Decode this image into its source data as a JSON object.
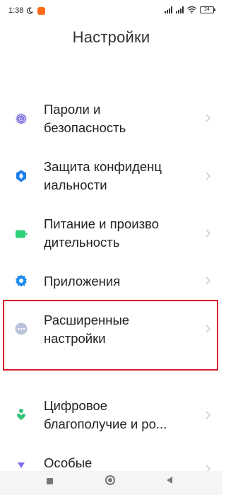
{
  "status_bar": {
    "time": "1:38",
    "battery": "24",
    "icons": [
      "moon-icon",
      "app-badge-icon",
      "signal-icon",
      "signal-icon-2",
      "wifi-icon",
      "battery-icon"
    ]
  },
  "page": {
    "title": "Настройки"
  },
  "settings": {
    "items": [
      {
        "label": "Пароли и\nбезопасность",
        "icon": "fingerprint-icon",
        "icon_color": "#6b5fd6"
      },
      {
        "label": "Защита конфиденц\nиальности",
        "icon": "privacy-icon",
        "icon_color": "#1f7fe8"
      },
      {
        "label": "Питание и произво\nдительность",
        "icon": "battery-power-icon",
        "icon_color": "#2fd17a"
      },
      {
        "label": "Приложения",
        "icon": "gear-icon",
        "icon_color": "#1a8cf0"
      },
      {
        "label": "Расширенные\nнастройки",
        "icon": "more-dots-icon",
        "icon_color": "#b9c3db",
        "highlighted": true
      },
      {
        "label": "Цифровое\nблагополучие и ро...",
        "icon": "wellbeing-icon",
        "icon_color": "#2fc47a"
      },
      {
        "label": "Особые",
        "icon": "special-icon",
        "icon_color": "#7b6ee6"
      }
    ]
  },
  "colors": {
    "highlight_border": "#d7192a",
    "chevron": "#c8c8c8",
    "text": "#222222"
  },
  "nav_bar": {
    "icons": [
      "recent-apps-icon",
      "home-icon",
      "back-icon"
    ]
  }
}
